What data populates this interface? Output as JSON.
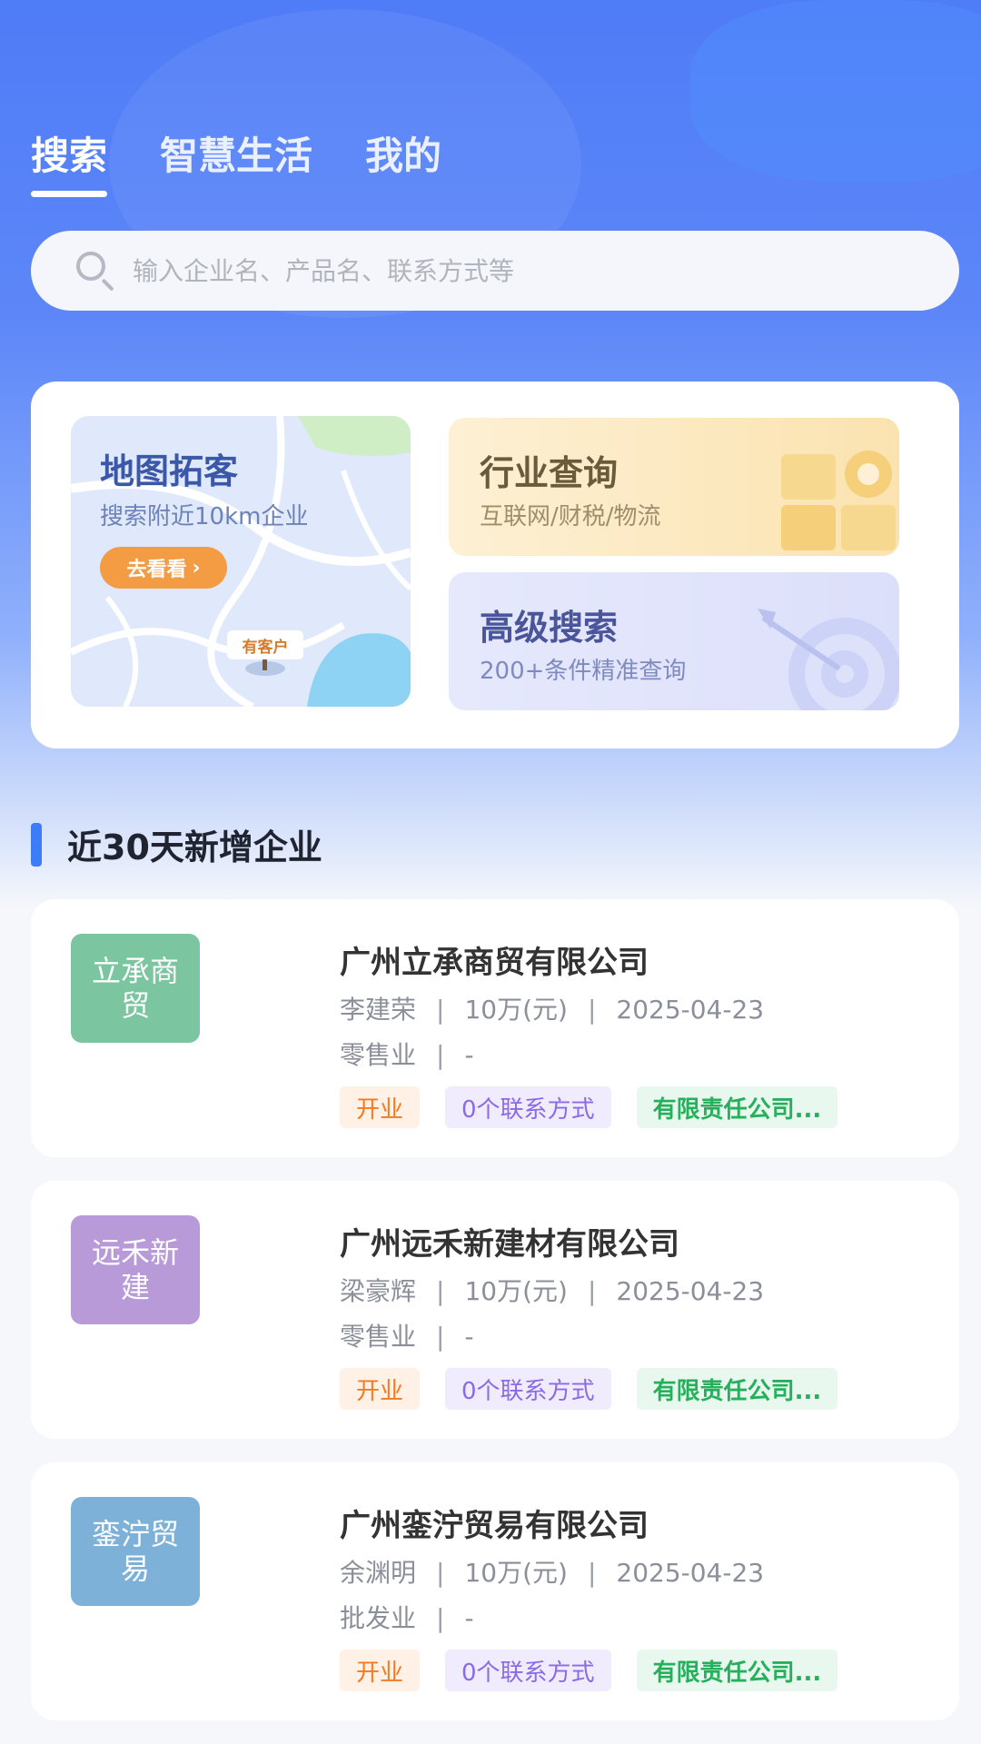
{
  "tabs": [
    {
      "label": "搜索",
      "active": true
    },
    {
      "label": "智慧生活",
      "active": false
    },
    {
      "label": "我的",
      "active": false
    }
  ],
  "search": {
    "placeholder": "输入企业名、产品名、联系方式等",
    "icon": "search-icon"
  },
  "features": {
    "map": {
      "title": "地图拓客",
      "subtitle": "搜索附近10km企业",
      "button": "去看看",
      "pin_label": "有客户"
    },
    "industry": {
      "title": "行业查询",
      "subtitle": "互联网/财税/物流"
    },
    "advanced": {
      "title": "高级搜索",
      "subtitle": "200+条件精准查询"
    }
  },
  "section": {
    "title": "近30天新增企业"
  },
  "companies": [
    {
      "logo_text": "立承商贸",
      "logo_color": "#7cc5a1",
      "name": "广州立承商贸有限公司",
      "legal_rep": "李建荣",
      "capital": "10万(元)",
      "date": "2025-04-23",
      "industry": "零售业",
      "extra": "-",
      "tags": {
        "status": "开业",
        "contacts": "0个联系方式",
        "type": "有限责任公司..."
      }
    },
    {
      "logo_text": "远禾新建",
      "logo_color": "#b89ad9",
      "name": "广州远禾新建材有限公司",
      "legal_rep": "梁豪辉",
      "capital": "10万(元)",
      "date": "2025-04-23",
      "industry": "零售业",
      "extra": "-",
      "tags": {
        "status": "开业",
        "contacts": "0个联系方式",
        "type": "有限责任公司..."
      }
    },
    {
      "logo_text": "銮泞贸易",
      "logo_color": "#7eb1d8",
      "name": "广州銮泞贸易有限公司",
      "legal_rep": "余渊明",
      "capital": "10万(元)",
      "date": "2025-04-23",
      "industry": "批发业",
      "extra": "-",
      "tags": {
        "status": "开业",
        "contacts": "0个联系方式",
        "type": "有限责任公司..."
      }
    }
  ],
  "colors": {
    "primary": "#4f7cf7",
    "accent": "#3d7cf7",
    "status_open": "#f47a1f",
    "contact": "#8a6ae6",
    "type": "#27b05c"
  }
}
